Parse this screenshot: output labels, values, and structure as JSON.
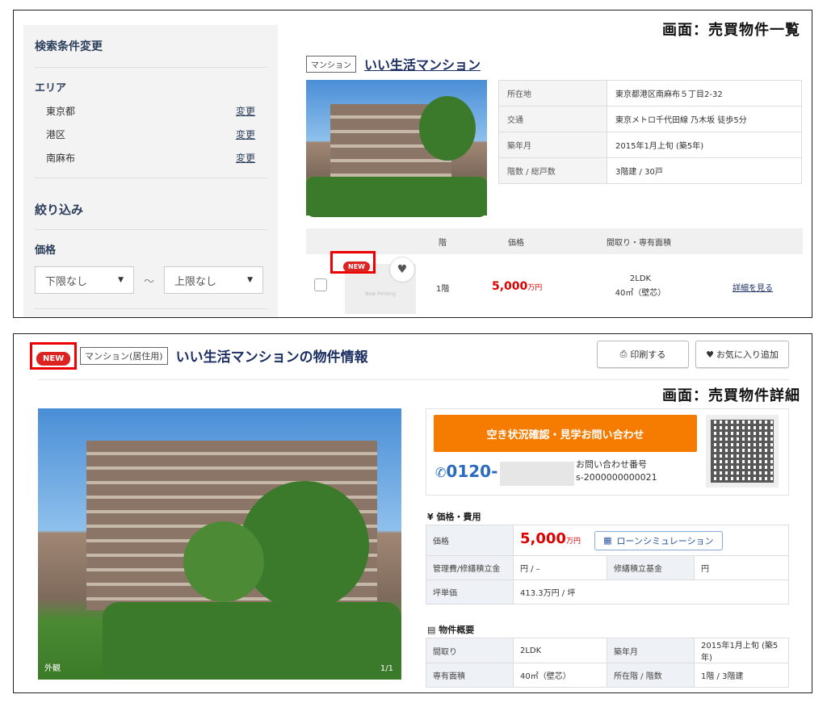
{
  "list_screen": {
    "label": "画面：売買物件一覧",
    "sidebar": {
      "title": "検索条件変更",
      "area_heading": "エリア",
      "areas": [
        {
          "name": "東京都",
          "action": "変更"
        },
        {
          "name": "港区",
          "action": "変更"
        },
        {
          "name": "南麻布",
          "action": "変更"
        }
      ],
      "filter_heading": "絞り込み",
      "price_heading": "価格",
      "price_min": "下限なし",
      "price_max": "上限なし",
      "tilde": "～"
    },
    "property": {
      "tag": "マンション",
      "name": "いい生活マンション",
      "info": [
        {
          "key": "所在地",
          "value": "東京都港区南麻布５丁目2-32"
        },
        {
          "key": "交通",
          "value": "東京メトロ千代田線 乃木坂 徒歩5分"
        },
        {
          "key": "築年月",
          "value": "2015年1月上旬 (築5年)"
        },
        {
          "key": "階数 / 総戸数",
          "value": "3階建 / 30戸"
        }
      ],
      "list_headers": {
        "floor": "階",
        "price": "価格",
        "layout": "間取り・専有面積"
      },
      "unit": {
        "new_badge": "NEW",
        "thumb_text": "Now Printing",
        "floor": "1階",
        "price": "5,000",
        "price_unit": "万円",
        "layout": "2LDK",
        "area": "40㎡（壁芯）",
        "detail_link": "詳細を見る"
      }
    }
  },
  "detail_screen": {
    "label": "画面：売買物件詳細",
    "new_badge": "NEW",
    "tag": "マンション(居住用)",
    "title": "いい生活マンションの物件情報",
    "print_button": "印刷する",
    "favorite_button": "お気に入り追加",
    "photo_caption": "外観",
    "photo_counter": "1/1",
    "cta": "空き状況確認・見学お問い合わせ",
    "phone_prefix": "0120-",
    "inquiry_label": "お問い合わせ番号",
    "inquiry_number": "s-2000000000021",
    "price_section": "価格・費用",
    "price_label": "価格",
    "price_value": "5,000",
    "price_unit": "万円",
    "loan_button": "ローンシミュレーション",
    "fees": [
      {
        "k1": "管理費/修繕積立金",
        "v1": "円 / –",
        "k2": "修繕積立基金",
        "v2": "円"
      }
    ],
    "tsubo_label": "坪単価",
    "tsubo_value": "413.3万円 / 坪",
    "overview_section": "物件概要",
    "overview": [
      {
        "k1": "間取り",
        "v1": "2LDK",
        "k2": "築年月",
        "v2": "2015年1月上旬 (築5年)"
      },
      {
        "k1": "専有面積",
        "v1": "40㎡（壁芯）",
        "k2": "所在階 / 階数",
        "v2": "1階 / 3階建"
      }
    ]
  }
}
